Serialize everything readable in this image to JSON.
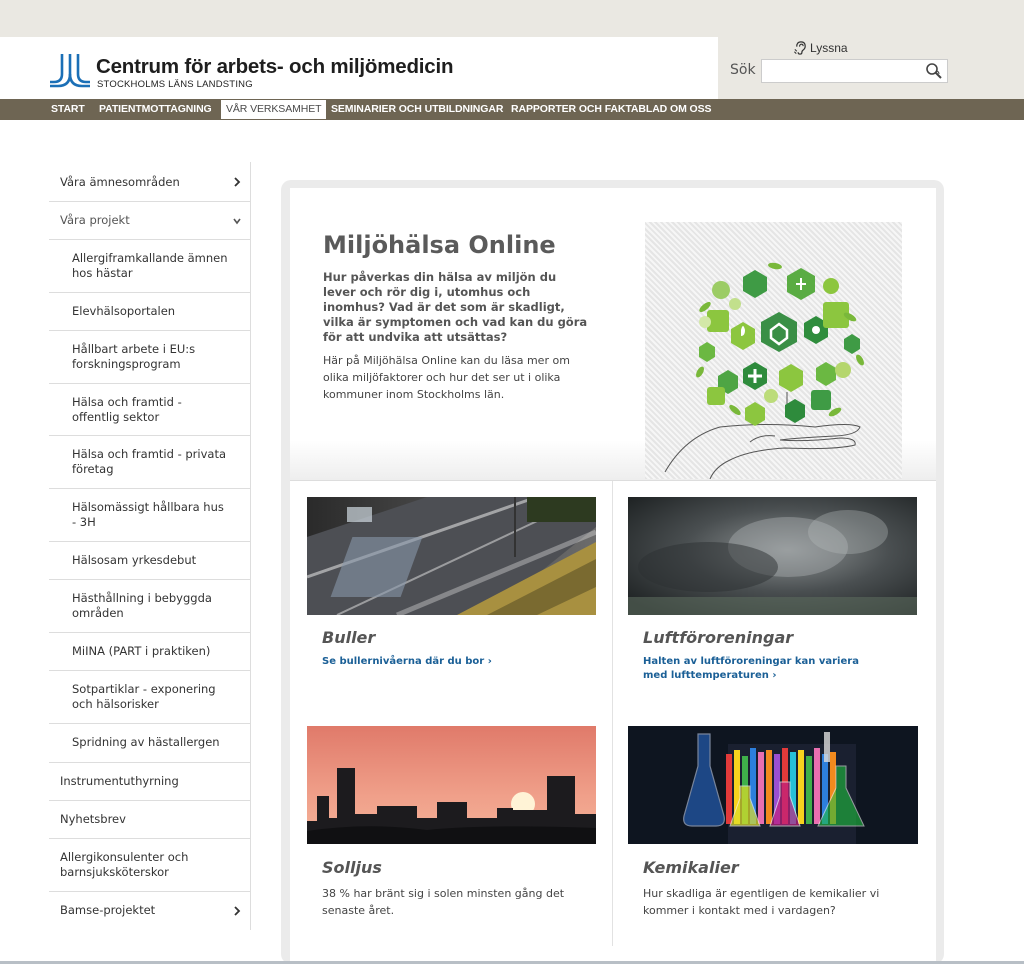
{
  "site": {
    "title": "Centrum för arbets- och miljömedicin",
    "subtitle": "STOCKHOLMS LÄNS LANDSTING"
  },
  "tools": {
    "listen_label": "Lyssna",
    "search_label": "Sök",
    "search_value": ""
  },
  "nav": {
    "items": [
      "START",
      "PATIENTMOTTAGNING",
      "VÅR VERKSAMHET",
      "SEMINARIER OCH UTBILDNINGAR",
      "RAPPORTER OCH FAKTABLAD",
      "OM OSS"
    ],
    "active": "VÅR VERKSAMHET"
  },
  "sidebar": {
    "items": [
      {
        "label": "Våra ämnesområden",
        "chevron": "right"
      },
      {
        "label": "Våra projekt",
        "chevron": "down"
      },
      {
        "label": "Allergiframkallande ämnen hos hästar"
      },
      {
        "label": "Elevhälsoportalen"
      },
      {
        "label": "Hållbart arbete i EU:s forskningsprogram"
      },
      {
        "label": "Hälsa och framtid - offentlig sektor"
      },
      {
        "label": "Hälsa och framtid - privata företag"
      },
      {
        "label": "Hälsomässigt hållbara hus - 3H"
      },
      {
        "label": "Hälsosam yrkesdebut"
      },
      {
        "label": "Hästhållning i bebyggda områden"
      },
      {
        "label": "MiINA (PART i praktiken)"
      },
      {
        "label": "Sotpartiklar - exponering och hälsorisker"
      },
      {
        "label": "Spridning av hästallergen"
      },
      {
        "label": "Instrumentuthyrning"
      },
      {
        "label": "Nyhetsbrev"
      },
      {
        "label": "Allergikonsulenter och barnsjuksköterskor"
      },
      {
        "label": "Bamse-projektet",
        "chevron": "right"
      }
    ]
  },
  "hero": {
    "title": "Miljöhälsa Online",
    "lead": "Hur påverkas din hälsa av miljön du lever och rör dig i, utomhus och inomhus? Vad är det som är skadligt, vilka är symptomen och vad kan du göra för att undvika att utsättas?",
    "body": "Här på Miljöhälsa Online kan du läsa mer om olika miljöfaktorer och hur det ser ut i olika kommuner inom Stockholms län."
  },
  "cards": [
    {
      "title": "Buller",
      "link": "Se bullernivåerna där du bor ›",
      "text": ""
    },
    {
      "title": "Luftföroreningar",
      "link": "Halten av luftföroreningar kan variera med lufttemperaturen ›",
      "text": ""
    },
    {
      "title": "Solljus",
      "link": "",
      "text": "38 % har bränt sig i solen minsten gång det senaste året."
    },
    {
      "title": "Kemikalier",
      "link": "",
      "text": "Hur skadliga är egentligen de kemikalier vi kommer i kontakt med i vardagen?"
    }
  ],
  "colors": {
    "nav_bg": "#6e6553",
    "link": "#1a5f96",
    "logo_blue": "#1b6fb6",
    "top_bg": "#eae8e2"
  }
}
